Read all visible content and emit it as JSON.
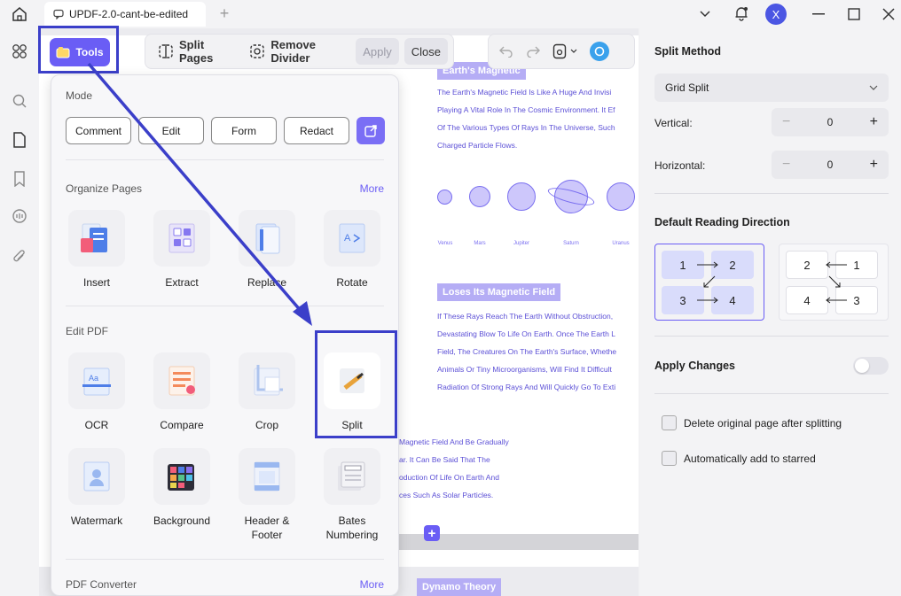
{
  "tab": {
    "title": "UPDF-2.0-cant-be-edited"
  },
  "user": {
    "initial": "X"
  },
  "tools_button": {
    "label": "Tools"
  },
  "toolbar": {
    "split_pages": "Split Pages",
    "remove_divider": "Remove Divider",
    "apply": "Apply",
    "close": "Close"
  },
  "panel": {
    "mode_title": "Mode",
    "modes": [
      "Comment",
      "Edit",
      "Form",
      "Redact"
    ],
    "organize_title": "Organize Pages",
    "edit_title": "Edit PDF",
    "converter_title": "PDF Converter",
    "more_label": "More",
    "organize_tools": [
      "Insert",
      "Extract",
      "Replace",
      "Rotate"
    ],
    "edit_tools": [
      "OCR",
      "Compare",
      "Crop",
      "Split"
    ],
    "edit_tools_row2": [
      "Watermark",
      "Background",
      "Header &\nFooter",
      "Bates\nNumbering"
    ]
  },
  "document": {
    "heading1": "Earth's Magnetic",
    "para1": [
      "The Earth's Magnetic Field Is Like A Huge And Invisi",
      "Playing A Vital Role In The Cosmic Environment. It Ef",
      "Of The Various Types Of Rays In The Universe, Such",
      "Charged Particle Flows."
    ],
    "planets": [
      "Venus",
      "Mars",
      "Jupiter",
      "Saturn",
      "Uranus"
    ],
    "heading2": "Loses Its Magnetic Field",
    "para2": [
      "If These Rays Reach The Earth Without Obstruction,",
      "Devastating Blow To Life On Earth. Once The Earth L",
      "Field, The Creatures On The Earth's Surface, Whethe",
      "Animals Or Tiny Microorganisms, Will Find It Difficult",
      "Radiation Of Strong Rays And Will Quickly Go To Exti"
    ],
    "para3": [
      "Magnetic Field And Be Gradually",
      "ar. It Can Be Said That The",
      "oduction Of Life On Earth And",
      "ces Such As Solar Particles."
    ],
    "heading3": "Dynamo Theory"
  },
  "right": {
    "split_method_title": "Split Method",
    "split_method_value": "Grid Split",
    "vertical_label": "Vertical:",
    "vertical_value": "0",
    "horizontal_label": "Horizontal:",
    "horizontal_value": "0",
    "reading_title": "Default Reading Direction",
    "apply_changes": "Apply Changes",
    "delete_original": "Delete original page after splitting",
    "auto_starred": "Automatically add to starred"
  },
  "colors": {
    "accent": "#6a5df5",
    "highlight": "#3b3fc9"
  }
}
